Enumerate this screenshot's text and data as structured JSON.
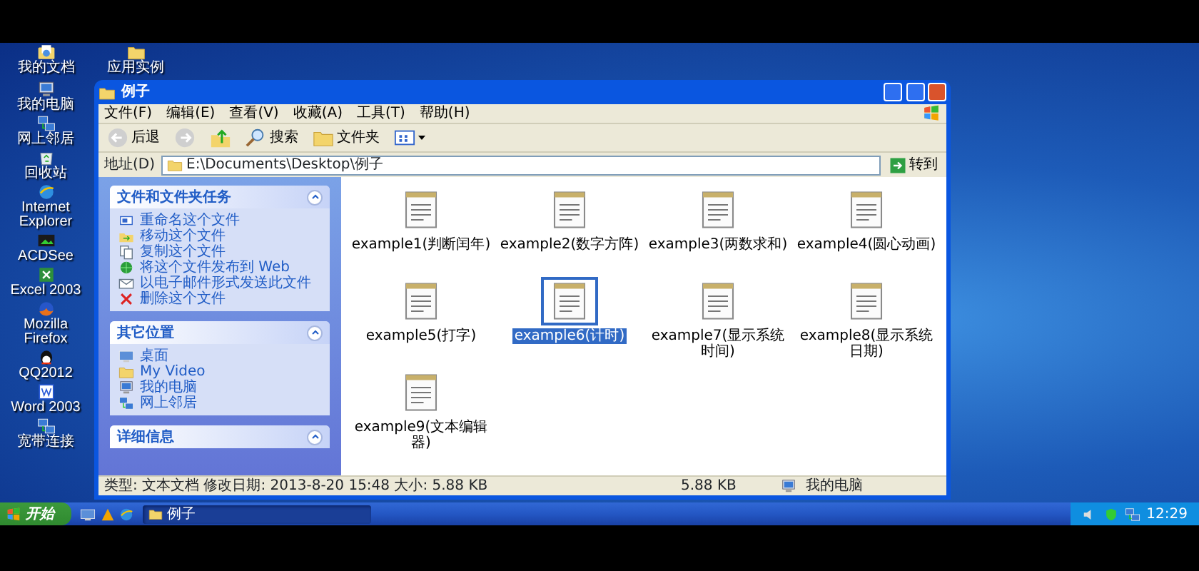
{
  "desktop_top_icons": [
    {
      "label": "我的文档",
      "kind": "docs"
    },
    {
      "label": "应用实例",
      "kind": "folder"
    }
  ],
  "desktop_icons": [
    {
      "label": "我的电脑",
      "kind": "computer"
    },
    {
      "label": "网上邻居",
      "kind": "network"
    },
    {
      "label": "回收站",
      "kind": "recycle"
    },
    {
      "label": "Internet Explorer",
      "kind": "globe"
    },
    {
      "label": "ACDSee",
      "kind": "photo"
    },
    {
      "label": "Excel 2003",
      "kind": "sheet"
    },
    {
      "label": "Mozilla Firefox",
      "kind": "fox"
    },
    {
      "label": "QQ2012",
      "kind": "penguin"
    },
    {
      "label": "Word 2003",
      "kind": "word"
    },
    {
      "label": "宽带连接",
      "kind": "network"
    }
  ],
  "window": {
    "title": "例子",
    "menu": [
      "文件(F)",
      "编辑(E)",
      "查看(V)",
      "收藏(A)",
      "工具(T)",
      "帮助(H)"
    ],
    "toolbar": [
      {
        "kind": "back",
        "label": "后退"
      },
      {
        "kind": "forward"
      },
      {
        "kind": "up"
      },
      {
        "kind": "search",
        "label": "搜索"
      },
      {
        "kind": "folders",
        "label": "文件夹"
      },
      {
        "kind": "views"
      }
    ],
    "address": {
      "label": "地址(D)",
      "path": "E:\\Documents\\Desktop\\例子",
      "go": "转到"
    },
    "task_panels": [
      {
        "title": "文件和文件夹任务",
        "items": [
          {
            "label": "重命名这个文件",
            "kind": "rename"
          },
          {
            "label": "移动这个文件",
            "kind": "move"
          },
          {
            "label": "复制这个文件",
            "kind": "copy"
          },
          {
            "label": "将这个文件发布到 Web",
            "kind": "web"
          },
          {
            "label": "以电子邮件形式发送此文件",
            "kind": "mail"
          },
          {
            "label": "删除这个文件",
            "kind": "delete"
          }
        ]
      },
      {
        "title": "其它位置",
        "items": [
          {
            "label": "桌面",
            "kind": "desktop"
          },
          {
            "label": "My Video",
            "kind": "folder"
          },
          {
            "label": "我的电脑",
            "kind": "computer"
          },
          {
            "label": "网上邻居",
            "kind": "network"
          }
        ]
      },
      {
        "title": "详细信息"
      }
    ],
    "files": [
      {
        "name": "example1(判断闰年)",
        "selected": false
      },
      {
        "name": "example2(数字方阵)",
        "selected": false
      },
      {
        "name": "example3(两数求和)",
        "selected": false
      },
      {
        "name": "example4(圆心动画)",
        "selected": false
      },
      {
        "name": "example5(打字)",
        "selected": false
      },
      {
        "name": "example6(计时)",
        "selected": true
      },
      {
        "name": "example7(显示系统时间)",
        "selected": false
      },
      {
        "name": "example8(显示系统日期)",
        "selected": false
      },
      {
        "name": "example9(文本编辑器)",
        "selected": false
      }
    ],
    "status_bar": {
      "details": "类型: 文本文档 修改日期: 2013-8-20 15:48 大小: 5.88 KB",
      "size": "5.88 KB",
      "location": "我的电脑"
    }
  },
  "taskbar": {
    "start": "开始",
    "quick_launch": [
      {
        "kind": "desktop"
      },
      {
        "kind": "warning"
      },
      {
        "kind": "globe"
      }
    ],
    "tasks": [
      {
        "label": "例子",
        "selected": true
      }
    ],
    "tray": [
      {
        "kind": "speaker"
      },
      {
        "kind": "shield"
      },
      {
        "kind": "network"
      }
    ],
    "clock": "12:29"
  }
}
